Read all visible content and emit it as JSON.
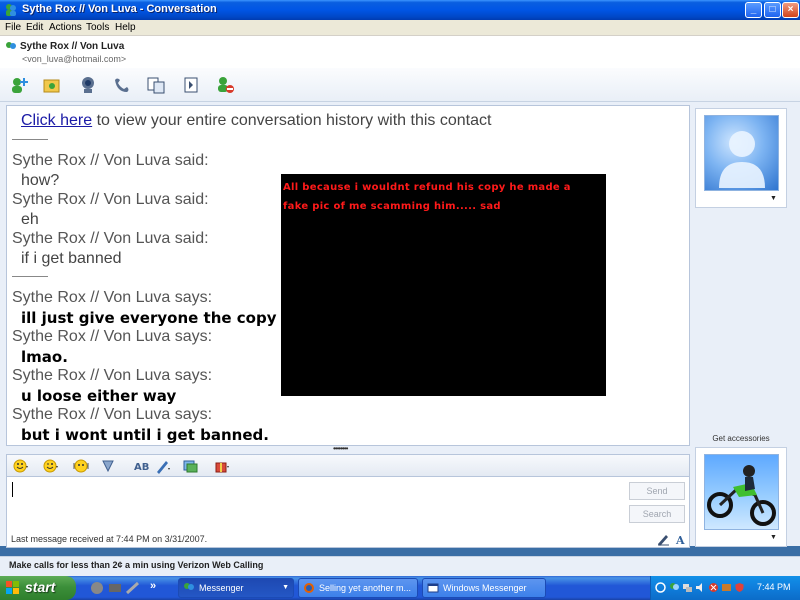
{
  "window": {
    "title": "Sythe Rox // Von Luva - Conversation",
    "buttons": {
      "minimize": "_",
      "maximize": "□",
      "close": "×"
    }
  },
  "menu": {
    "items": [
      "File",
      "Edit",
      "Actions",
      "Tools",
      "Help"
    ]
  },
  "contact": {
    "name": "Sythe Rox // Von Luva",
    "email": "<von_luva@hotmail.com>"
  },
  "toolbar": {
    "icons": [
      "invite-contact-icon",
      "send-files-icon",
      "webcam-icon",
      "call-icon",
      "activities-icon",
      "games-icon",
      "block-icon"
    ]
  },
  "history": {
    "link_text": "Click here",
    "link_suffix": " to view your entire conversation history with this contact",
    "old_messages": [
      {
        "sender": "Sythe Rox // Von Luva said:",
        "text": "how?"
      },
      {
        "sender": "Sythe Rox // Von Luva said:",
        "text": "eh"
      },
      {
        "sender": "Sythe Rox // Von Luva said:",
        "text": "if i get banned"
      }
    ],
    "new_messages": [
      {
        "sender": "Sythe Rox // Von Luva says:",
        "text": "ill just give everyone the copy"
      },
      {
        "sender": "Sythe Rox // Von Luva says:",
        "text": "lmao."
      },
      {
        "sender": "Sythe Rox // Von Luva says:",
        "text": "u loose either way"
      },
      {
        "sender": "Sythe Rox // Von Luva says:",
        "text": "but i wont until i get banned."
      }
    ],
    "overlay_text": "All because i wouldnt refund his copy he made a fake pic of me scamming him..... sad"
  },
  "compose": {
    "send_label": "Send",
    "search_label": "Search",
    "format_icons": [
      "emoticon-icon",
      "wink-icon",
      "nudge-icon",
      "voice-clip-icon",
      "font-icon",
      "handwriting-icon",
      "background-icon",
      "gift-icon"
    ]
  },
  "status": {
    "last_message": "Last message received at 7:44 PM on 3/31/2007."
  },
  "sidebar": {
    "accessories": "Get accessories"
  },
  "ad": {
    "text": "Make calls for less than 2¢ a min using Verizon Web Calling"
  },
  "taskbar": {
    "start_label": "start",
    "tasks": [
      {
        "label": "Messenger",
        "active": true
      },
      {
        "label": "Selling yet another m...",
        "active": false
      },
      {
        "label": "Windows Messenger",
        "active": false
      }
    ],
    "clock": "7:44 PM"
  }
}
